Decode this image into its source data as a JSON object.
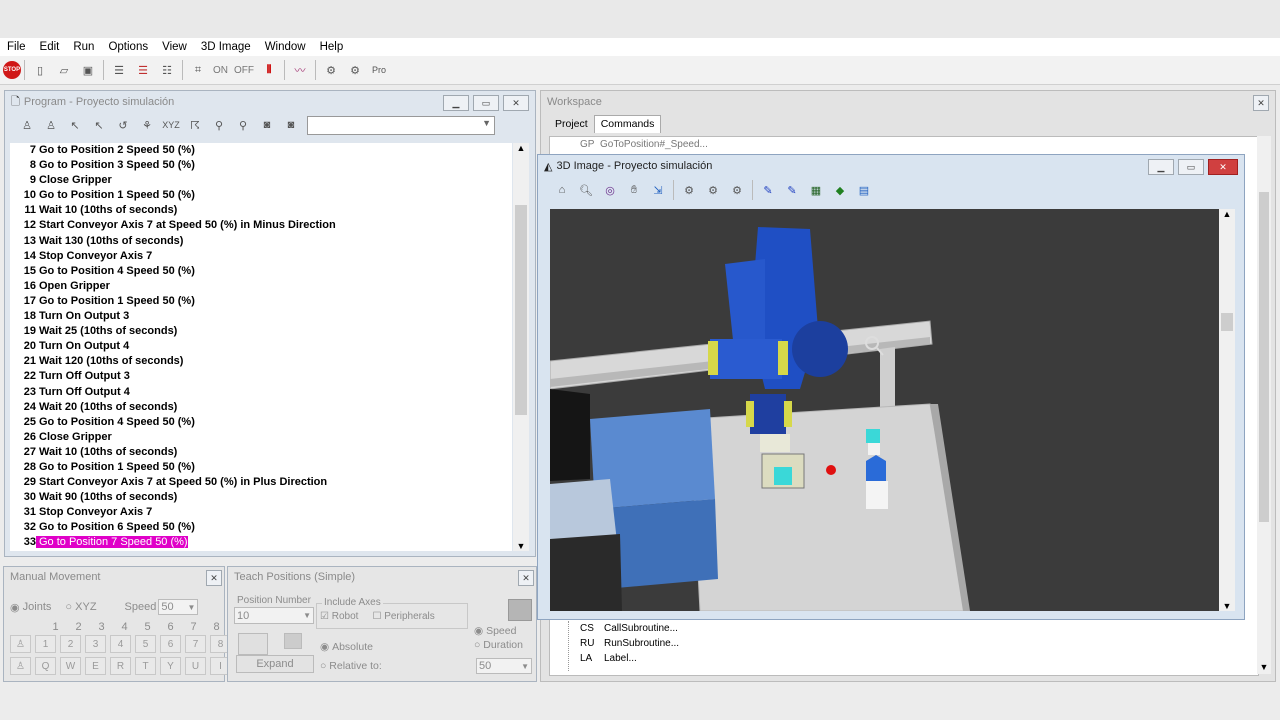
{
  "menu": [
    "File",
    "Edit",
    "Run",
    "Options",
    "View",
    "3D Image",
    "Window",
    "Help"
  ],
  "toolbar": {
    "stop_label": "STOP",
    "on_label": "ON",
    "off_label": "OFF",
    "pro_label": "Pro"
  },
  "program": {
    "title": "Program - Proyecto simulación",
    "rows": [
      {
        "num": "7",
        "text": "Go to Position 2 Speed 50 (%)"
      },
      {
        "num": "8",
        "text": "Go to Position 3 Speed 50 (%)"
      },
      {
        "num": "9",
        "text": "Close Gripper"
      },
      {
        "num": "10",
        "text": "Go to Position 1 Speed 50 (%)"
      },
      {
        "num": "11",
        "text": "Wait 10 (10ths of seconds)"
      },
      {
        "num": "12",
        "text": "Start Conveyor Axis 7 at Speed 50 (%) in Minus Direction"
      },
      {
        "num": "13",
        "text": "Wait 130 (10ths of seconds)"
      },
      {
        "num": "14",
        "text": "Stop Conveyor Axis 7"
      },
      {
        "num": "15",
        "text": "Go to Position 4 Speed 50 (%)"
      },
      {
        "num": "16",
        "text": "Open Gripper"
      },
      {
        "num": "17",
        "text": "Go to Position 1 Speed 50 (%)"
      },
      {
        "num": "18",
        "text": "Turn On Output 3"
      },
      {
        "num": "19",
        "text": "Wait 25 (10ths of seconds)"
      },
      {
        "num": "20",
        "text": "Turn On Output 4"
      },
      {
        "num": "21",
        "text": "Wait 120 (10ths of seconds)"
      },
      {
        "num": "22",
        "text": "Turn Off Output 3"
      },
      {
        "num": "23",
        "text": "Turn Off Output 4"
      },
      {
        "num": "24",
        "text": "Wait 20 (10ths of seconds)"
      },
      {
        "num": "25",
        "text": "Go to Position 4 Speed 50 (%)"
      },
      {
        "num": "26",
        "text": "Close Gripper"
      },
      {
        "num": "27",
        "text": "Wait 10 (10ths of seconds)"
      },
      {
        "num": "28",
        "text": "Go to Position 1 Speed 50 (%)"
      },
      {
        "num": "29",
        "text": "Start Conveyor Axis 7 at Speed 50 (%) in Plus Direction"
      },
      {
        "num": "30",
        "text": "Wait 90 (10ths of seconds)"
      },
      {
        "num": "31",
        "text": "Stop Conveyor Axis 7"
      },
      {
        "num": "32",
        "text": "Go to Position 6 Speed 50 (%)"
      },
      {
        "num": "33",
        "text": "Go to Position 7 Speed 50 (%)",
        "selected": true
      }
    ]
  },
  "manual": {
    "title": "Manual Movement",
    "joints": "Joints",
    "xyz": "XYZ",
    "speed_label": "Speed",
    "speed_value": "50",
    "numbers": [
      "1",
      "2",
      "3",
      "4",
      "5",
      "6",
      "7",
      "8"
    ],
    "letters": [
      "Q",
      "W",
      "E",
      "R",
      "T",
      "Y",
      "U",
      "I"
    ]
  },
  "teach": {
    "title": "Teach Positions (Simple)",
    "position_number": "Position Number",
    "position_value": "10",
    "include_axes": "Include Axes",
    "robot": "Robot",
    "peripherals": "Peripherals",
    "absolute": "Absolute",
    "relative": "Relative to:",
    "expand": "Expand",
    "speed": "Speed",
    "duration": "Duration",
    "speed_value": "50"
  },
  "workspace": {
    "title": "Workspace",
    "tabs": [
      "Project",
      "Commands"
    ],
    "top_item": {
      "code": "GP",
      "label": "GoToPosition#_Speed..."
    },
    "items": [
      {
        "code": "CS",
        "label": "CallSubroutine..."
      },
      {
        "code": "RU",
        "label": "RunSubroutine..."
      },
      {
        "code": "LA",
        "label": "Label..."
      }
    ]
  },
  "image3d": {
    "title": "3D Image - Proyecto simulación"
  },
  "colors": {
    "selection": "#e000c8",
    "robot": "#1f4fc4",
    "stop": "#d01818"
  }
}
